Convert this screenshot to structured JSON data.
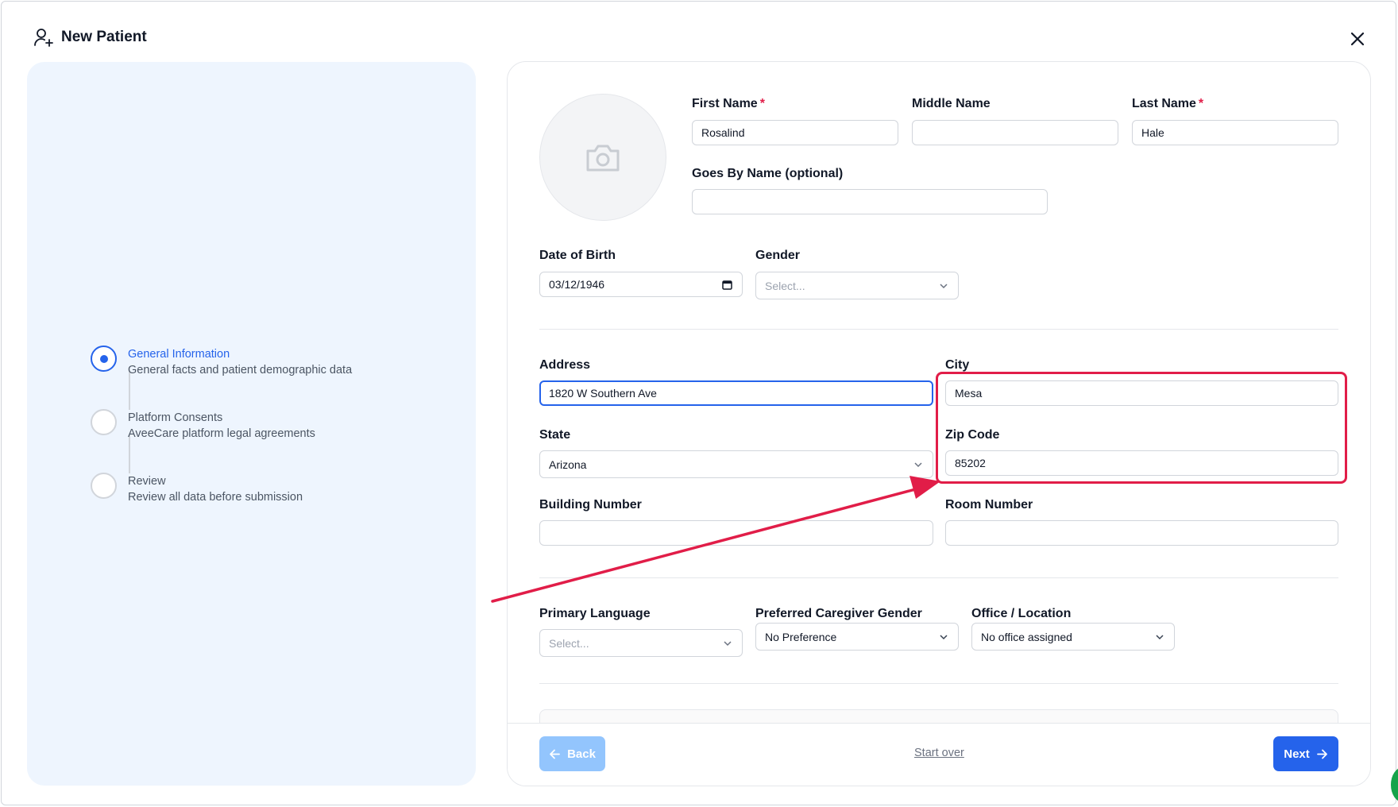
{
  "header": {
    "title": "New Patient"
  },
  "steps": [
    {
      "title": "General Information",
      "description": "General facts and patient demographic data",
      "active": true
    },
    {
      "title": "Platform Consents",
      "description": "AveeCare platform legal agreements",
      "active": false
    },
    {
      "title": "Review",
      "description": "Review all data before submission",
      "active": false
    }
  ],
  "form": {
    "first_name": {
      "label": "First Name",
      "required_mark": "*",
      "value": "Rosalind"
    },
    "middle_name": {
      "label": "Middle Name",
      "value": ""
    },
    "last_name": {
      "label": "Last Name",
      "required_mark": "*",
      "value": "Hale"
    },
    "goes_by": {
      "label": "Goes By Name (optional)",
      "value": ""
    },
    "dob": {
      "label": "Date of Birth",
      "value": "03/12/1946"
    },
    "gender": {
      "label": "Gender",
      "placeholder": "Select..."
    },
    "address": {
      "label": "Address",
      "value": "1820 W Southern Ave"
    },
    "city": {
      "label": "City",
      "value": "Mesa"
    },
    "state": {
      "label": "State",
      "value": "Arizona"
    },
    "zip": {
      "label": "Zip Code",
      "value": "85202"
    },
    "building": {
      "label": "Building Number",
      "value": ""
    },
    "room": {
      "label": "Room Number",
      "value": ""
    },
    "language": {
      "label": "Primary Language",
      "placeholder": "Select..."
    },
    "caregiver_gender": {
      "label": "Preferred Caregiver Gender",
      "value": "No Preference"
    },
    "office": {
      "label": "Office / Location",
      "value": "No office assigned"
    }
  },
  "footer": {
    "back_label": "Back",
    "start_over_label": "Start over",
    "next_label": "Next"
  },
  "colors": {
    "accent": "#2563eb",
    "annotation": "#e11d48",
    "panel_bg": "#eef5fe"
  }
}
